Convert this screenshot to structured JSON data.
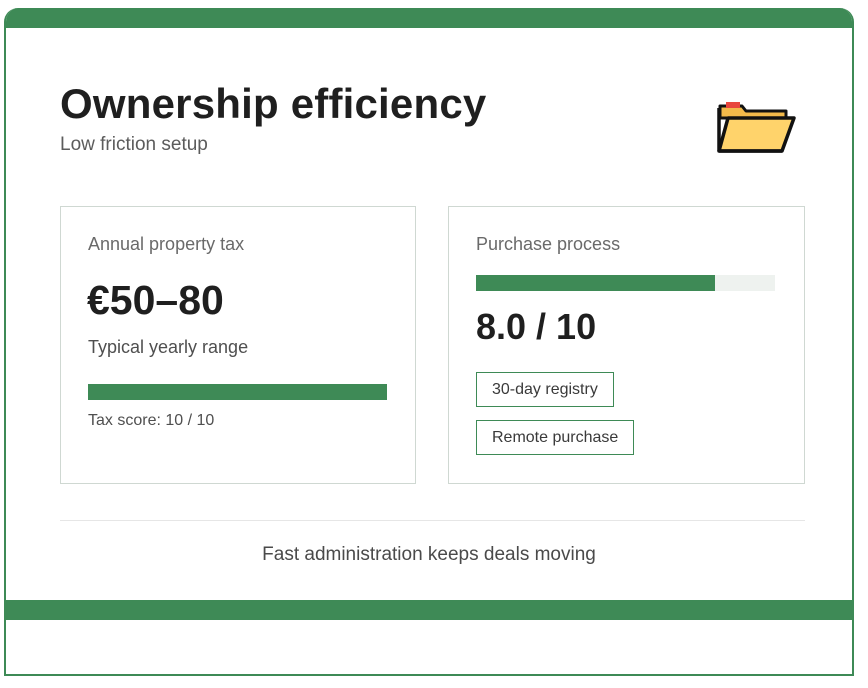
{
  "header": {
    "title": "Ownership efficiency",
    "subtitle": "Low friction setup",
    "icon": "folder-icon"
  },
  "colors": {
    "accent": "#3e8a56",
    "track": "#eef2ef",
    "border": "#cfd8d2",
    "folder_fill": "#ffd36b",
    "folder_tab": "#e8463d"
  },
  "tax_card": {
    "label": "Annual property tax",
    "value": "€50–80",
    "note": "Typical yearly range",
    "score_text": "Tax score: 10 / 10",
    "score_fraction": 1.0
  },
  "process_card": {
    "label": "Purchase process",
    "rating": "8.0 / 10",
    "score_fraction": 0.8,
    "tags": [
      "30-day registry",
      "Remote purchase"
    ]
  },
  "footer": {
    "text": "Fast administration keeps deals moving"
  }
}
